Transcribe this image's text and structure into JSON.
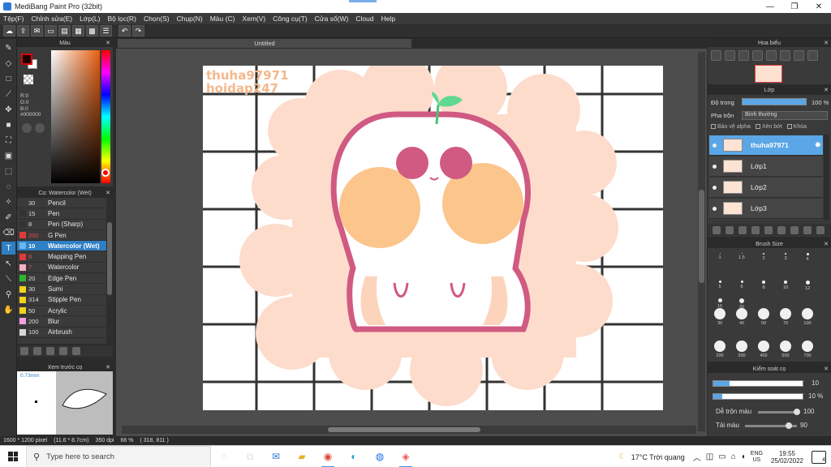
{
  "window": {
    "title": "MediBang Paint Pro (32bit)",
    "controls": {
      "minimize": "—",
      "maximize": "❐",
      "close": "✕"
    }
  },
  "menu": [
    "Tệp(F)",
    "Chỉnh sửa(E)",
    "Lớp(L)",
    "Bộ lọc(R)",
    "Chọn(S)",
    "Chụp(N)",
    "Màu (C)",
    "Xem(V)",
    "Công cụ(T)",
    "Cửa sổ(W)",
    "Cloud",
    "Help"
  ],
  "color_panel": {
    "title": "Màu",
    "close": "✕",
    "r": "R:0",
    "g": "G:0",
    "b": "B:0",
    "hex": "#000000",
    "fg_color": "#1a0000"
  },
  "brush_panel": {
    "title": "Cọ: Watercolor (Wet)",
    "close": "✕",
    "items": [
      {
        "size": "30",
        "name": "Pencil",
        "color": "#3a3a3a",
        "active": false
      },
      {
        "size": "15",
        "name": "Pen",
        "color": "#333333",
        "active": false
      },
      {
        "size": "8",
        "name": "Pen (Sharp)",
        "color": "#333333",
        "active": false
      },
      {
        "size": "200",
        "name": "G Pen",
        "color": "#e03a3a",
        "active": false
      },
      {
        "size": "10",
        "name": "Watercolor (Wet)",
        "color": "#6ab8ea",
        "active": true
      },
      {
        "size": "8",
        "name": "Mapping Pen",
        "color": "#e03a3a",
        "active": false
      },
      {
        "size": "7",
        "name": "Watercolor",
        "color": "#f7b0c0",
        "active": false
      },
      {
        "size": "20",
        "name": "Edge Pen",
        "color": "#2fb52f",
        "active": false
      },
      {
        "size": "30",
        "name": "Sumi",
        "color": "#f2d21a",
        "active": false
      },
      {
        "size": "314",
        "name": "Stipple Pen",
        "color": "#f2d21a",
        "active": false
      },
      {
        "size": "50",
        "name": "Acrylic",
        "color": "#f2d21a",
        "active": false
      },
      {
        "size": "200",
        "name": "Blur",
        "color": "#f2a0e0",
        "active": false
      },
      {
        "size": "100",
        "name": "Airbrush",
        "color": "#d8d8d8",
        "active": false
      }
    ]
  },
  "preview_panel": {
    "title": "Xem trước cọ",
    "close": "✕",
    "size": "0.73mm"
  },
  "canvas": {
    "tab": "Untitled",
    "watermark_1": "thuha97971",
    "watermark_2": "hoidap247"
  },
  "navigator": {
    "title": "Hoa biểu",
    "close": "✕"
  },
  "layer_panel": {
    "title": "Lớp",
    "close": "✕",
    "opacity_label": "Độ trong",
    "opacity_value": "100 %",
    "opacity_fraction": 1.0,
    "blend_label": "Pha trộn",
    "blend_value": "Bình thường",
    "protect_alpha": "Bảo vệ alpha",
    "clipping": "Xén bớt",
    "lock": "Khóa",
    "layers": [
      {
        "name": "thuha97971",
        "active": true
      },
      {
        "name": "Lớp1",
        "active": false
      },
      {
        "name": "Lớp2",
        "active": false
      },
      {
        "name": "Lớp3",
        "active": false
      }
    ]
  },
  "brush_size_panel": {
    "title": "Brush Size",
    "close": "✕",
    "sizes": [
      "1",
      "1.5",
      "2",
      "3",
      "4",
      "5",
      "6",
      "8",
      "10",
      "12",
      "15",
      "20",
      "30",
      "40",
      "50",
      "70",
      "100",
      "200",
      "300",
      "400",
      "500",
      "700"
    ]
  },
  "brush_control": {
    "title": "Kiểm soát cọ",
    "close": "✕",
    "size_value": "10",
    "size_fraction": 0.18,
    "opacity_value": "10 %",
    "opacity_fraction": 0.1,
    "blend_label": "Dễ trộn màu",
    "blend_value": "100",
    "blend_fraction": 1.0,
    "refill_label": "Tải màu",
    "refill_value": "90",
    "refill_fraction": 0.9
  },
  "status": {
    "dimensions": "1600 * 1200 pixel",
    "physical": "(11.6 * 8.7cm)",
    "dpi": "350 dpi",
    "zoom": "66 %",
    "cursor": "( 318, 811 )"
  },
  "taskbar": {
    "search_placeholder": "Type here to search",
    "weather": "17°C  Trời quang",
    "lang_1": "ENG",
    "lang_2": "US",
    "time": "19:55",
    "date": "25/02/2022",
    "notifications": "4"
  }
}
